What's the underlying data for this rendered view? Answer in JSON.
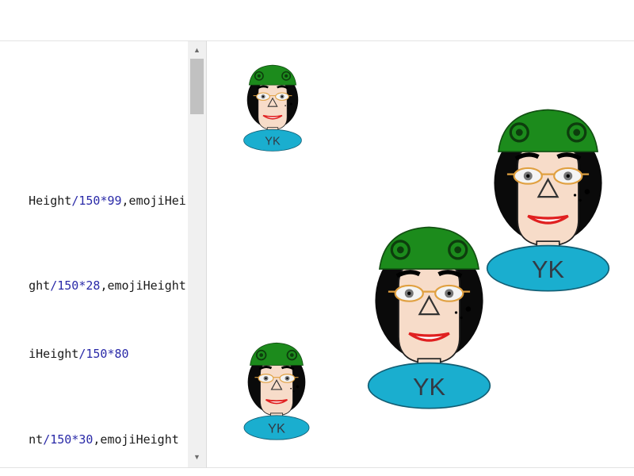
{
  "code_editor": {
    "lines": [
      {
        "pre": "Height",
        "op": "/",
        "n1": "150",
        "op2": "*",
        "n2": "99",
        "post": ",emojiHei"
      },
      {
        "pre": "ght",
        "op": "/",
        "n1": "150",
        "op2": "*",
        "n2": "28",
        "post": ",emojiHeight"
      },
      {
        "pre": "iHeight",
        "op": "/",
        "n1": "150",
        "op2": "*",
        "n2": "80",
        "post": ""
      },
      {
        "pre": "nt",
        "op": "/",
        "n1": "150",
        "op2": "*",
        "n2": "30",
        "post": ",emojiHeight"
      }
    ],
    "scroll_up_icon": "triangle-up",
    "scroll_down_icon": "triangle-down"
  },
  "preview": {
    "emojis": [
      {
        "badge_text": "YK"
      },
      {
        "badge_text": "YK"
      },
      {
        "badge_text": "YK"
      },
      {
        "badge_text": "YK"
      }
    ],
    "colors": {
      "hat": "#1c8b1c",
      "skin": "#f7dcc9",
      "hair": "#0a0a0a",
      "badge": "#1aaecf",
      "lips": "#e02020",
      "glasses": "#e0a040"
    }
  }
}
